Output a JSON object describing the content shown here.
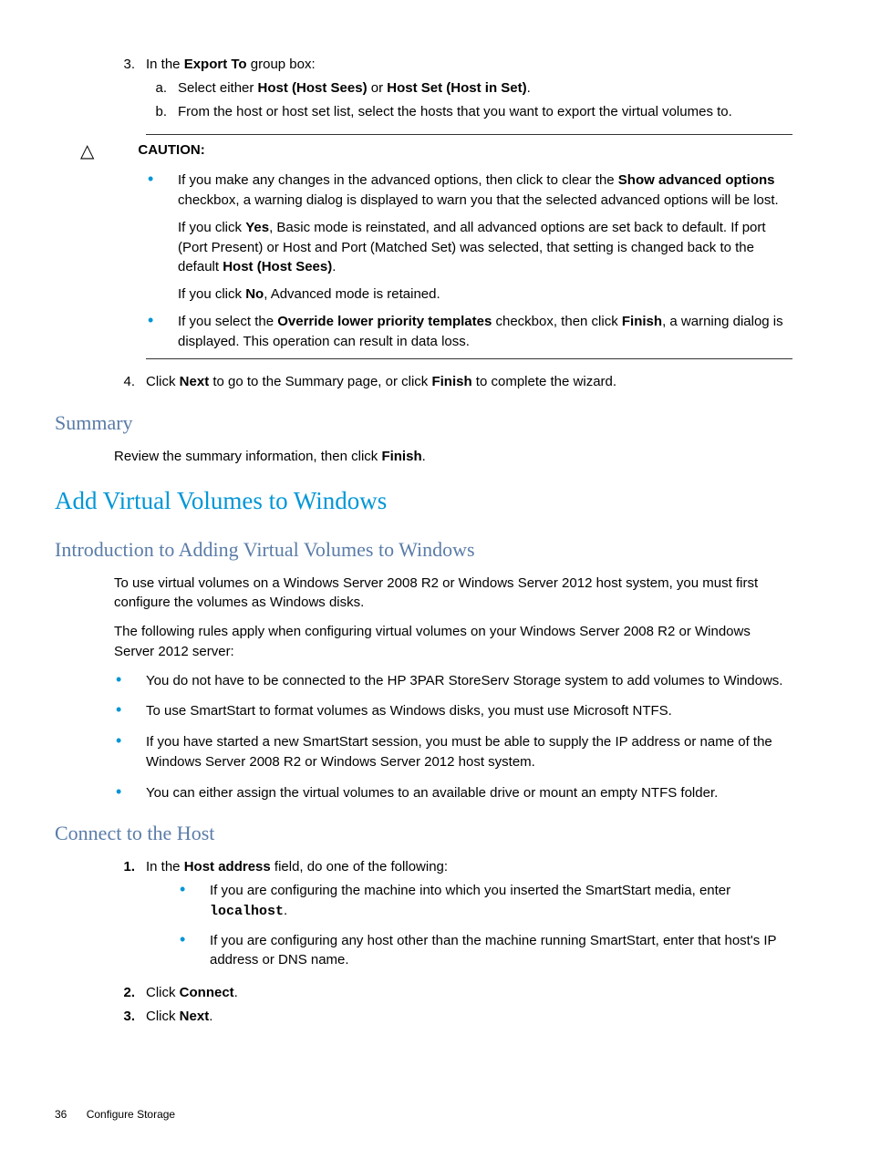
{
  "step3": {
    "num": "3.",
    "intro_pre": "In the ",
    "intro_bold": "Export To",
    "intro_post": " group box:",
    "a": {
      "letter": "a.",
      "pre": "Select either ",
      "bold1": "Host (Host Sees)",
      "mid": " or ",
      "bold2": "Host Set (Host in Set)",
      "post": "."
    },
    "b": {
      "letter": "b.",
      "text": "From the host or host set list, select the hosts that you want to export the virtual volumes to."
    }
  },
  "caution": {
    "icon": "△",
    "label": "CAUTION:",
    "item1": {
      "p1_pre": "If you make any changes in the advanced options, then click to clear the ",
      "p1_bold": "Show advanced options",
      "p1_post": " checkbox, a warning dialog is displayed to warn you that the selected advanced options will be lost.",
      "p2_pre": "If you click ",
      "p2_bold1": "Yes",
      "p2_mid": ", Basic mode is reinstated, and all advanced options are set back to default. If port (Port Present) or Host and Port (Matched Set) was selected, that setting is changed back to the default ",
      "p2_bold2": "Host (Host Sees)",
      "p2_post": ".",
      "p3_pre": "If you click ",
      "p3_bold": "No",
      "p3_post": ", Advanced mode is retained."
    },
    "item2": {
      "pre": "If you select the ",
      "bold1": "Override lower priority templates",
      "mid": " checkbox, then click ",
      "bold2": "Finish",
      "post": ", a warning dialog is displayed. This operation can result in data loss."
    }
  },
  "step4": {
    "num": "4.",
    "pre": "Click ",
    "bold1": "Next",
    "mid": " to go to the Summary page, or click ",
    "bold2": "Finish",
    "post": " to complete the wizard."
  },
  "summary": {
    "heading": "Summary",
    "text_pre": "Review the summary information, then click ",
    "text_bold": "Finish",
    "text_post": "."
  },
  "addvv": {
    "heading": "Add Virtual Volumes to Windows"
  },
  "intro": {
    "heading": "Introduction to Adding Virtual Volumes to Windows",
    "p1": "To use virtual volumes on a Windows Server 2008 R2 or Windows Server 2012 host system, you must first configure the volumes as Windows disks.",
    "p2": "The following rules apply when configuring virtual volumes on your Windows Server 2008 R2 or Windows Server 2012 server:",
    "rules": [
      "You do not have to be connected to the HP 3PAR StoreServ Storage system to add volumes to Windows.",
      "To use SmartStart to format volumes as Windows disks, you must use Microsoft NTFS.",
      "If you have started a new SmartStart session, you must be able to supply the IP address or name of the Windows Server 2008 R2 or Windows Server 2012 host system.",
      "You can either assign the virtual volumes to an available drive or mount an empty NTFS folder."
    ]
  },
  "connect": {
    "heading": "Connect to the Host",
    "step1": {
      "num": "1.",
      "pre": "In the ",
      "bold": "Host address",
      "post": " field, do one of the following:",
      "sub1_pre": "If you are configuring the machine into which you inserted the SmartStart media, enter ",
      "sub1_mono": "localhost",
      "sub1_post": ".",
      "sub2": "If you are configuring any host other than the machine running SmartStart, enter that host's IP address or DNS name."
    },
    "step2": {
      "num": "2.",
      "pre": "Click ",
      "bold": "Connect",
      "post": "."
    },
    "step3": {
      "num": "3.",
      "pre": "Click ",
      "bold": "Next",
      "post": "."
    }
  },
  "footer": {
    "page": "36",
    "section": "Configure Storage"
  }
}
